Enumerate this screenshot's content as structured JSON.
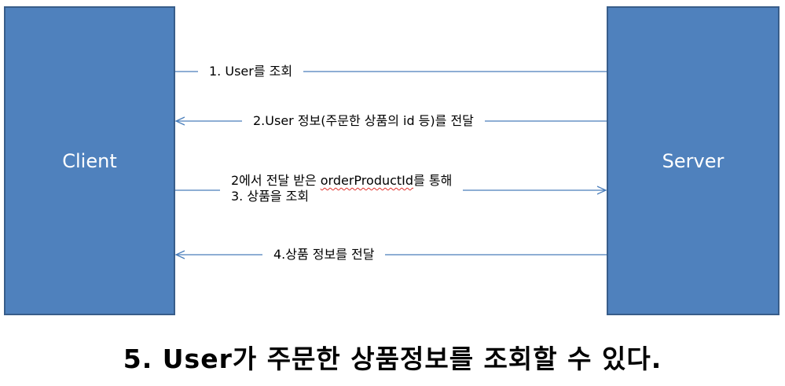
{
  "nodes": {
    "client": "Client",
    "server": "Server"
  },
  "messages": {
    "step1": "1. User를 조회",
    "step2": "2.User 정보(주문한 상품의 id 등)를 전달",
    "step3_line1_prefix": "2에서 전달 받은 ",
    "step3_line1_term": "orderProductId",
    "step3_line1_suffix": "를 통해",
    "step3_line2": "3. 상품을 조회",
    "step4": "4.상품 정보를 전달"
  },
  "caption": "5. User가 주문한 상품정보를 조회할 수 있다.",
  "colors": {
    "box_fill": "#4f81bd",
    "box_border": "#385d8a",
    "arrow": "#4a7ebb",
    "spellcheck_underline": "#e0302a"
  }
}
